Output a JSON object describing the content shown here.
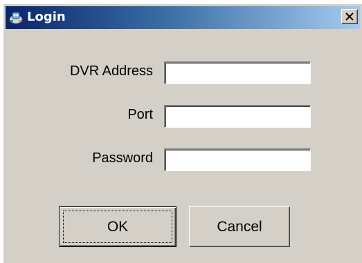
{
  "window": {
    "title": "Login",
    "icon": "login-app-icon",
    "close_icon": "close-icon"
  },
  "form": {
    "dvr_address": {
      "label": "DVR Address",
      "value": ""
    },
    "port": {
      "label": "Port",
      "value": ""
    },
    "password": {
      "label": "Password",
      "value": ""
    }
  },
  "buttons": {
    "ok": "OK",
    "cancel": "Cancel"
  },
  "colors": {
    "titlebar_start": "#0a246a",
    "titlebar_end": "#a6caf0",
    "dialog_face": "#d4d0c8"
  }
}
